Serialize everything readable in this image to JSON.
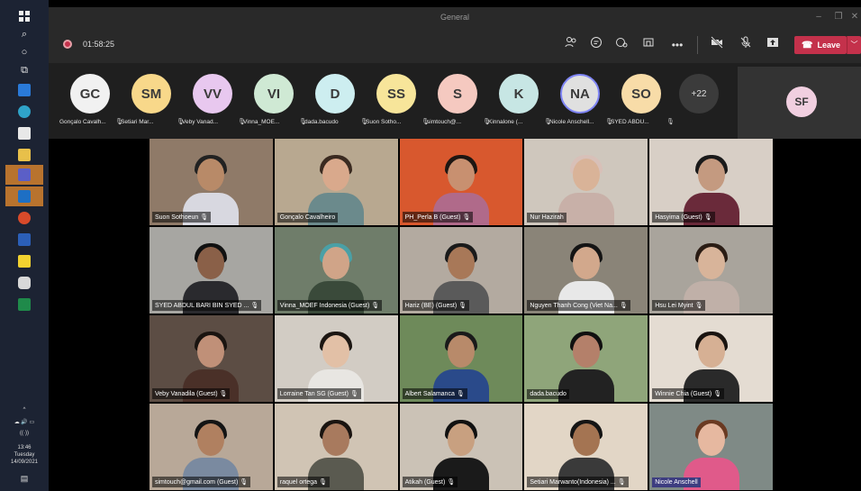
{
  "window": {
    "title": "General"
  },
  "controls": {
    "timer": "01:58:25",
    "leave_label": "Leave"
  },
  "strip": {
    "participants": [
      {
        "initials": "GC",
        "name": "Gonçalo Cavalh...",
        "color": "#f1f1f1"
      },
      {
        "initials": "SM",
        "name": "Setiari Mar...",
        "color": "#f8d88a"
      },
      {
        "initials": "VV",
        "name": "Veby Vanad...",
        "color": "#e8c8ef"
      },
      {
        "initials": "VI",
        "name": "Vinna_MOE...",
        "color": "#cfe9d4"
      },
      {
        "initials": "D",
        "name": "dada.bacudo",
        "color": "#cdeef0"
      },
      {
        "initials": "SS",
        "name": "Suon Sotho...",
        "color": "#f7e59a"
      },
      {
        "initials": "S",
        "name": "simtouch@...",
        "color": "#f5c9c0"
      },
      {
        "initials": "K",
        "name": "Kinnalone (...",
        "color": "#c7e6e4"
      },
      {
        "initials": "NA",
        "name": "Nicole Anschell...",
        "color": "#e0e0e0"
      },
      {
        "initials": "SO",
        "name": "SYED ABDU...",
        "color": "#f8dca8"
      }
    ],
    "more_label": "+22",
    "self_initials": "SF"
  },
  "taskbar": {
    "time": "13:46",
    "day": "Tuesday",
    "date": "14/09/2021"
  },
  "tiles": [
    {
      "name": "Suon Sothoeun",
      "bg": "#8f7a68",
      "skin": "#b88a68",
      "shirt": "#d8d8e0",
      "hair": "#222"
    },
    {
      "name": "Gonçalo Cavalheiro",
      "bg": "#b8a890",
      "skin": "#d9a98c",
      "shirt": "#6b8a8c",
      "hair": "#3a2a20"
    },
    {
      "name": "PH_Perla B (Guest)",
      "bg": "#d8582e",
      "skin": "#c89070",
      "shirt": "#b06a8a",
      "hair": "#1e1612"
    },
    {
      "name": "Nur Hazirah",
      "bg": "#cfc7bd",
      "skin": "#d9b398",
      "shirt": "#c8b0a8",
      "hair": "#d8c0b8"
    },
    {
      "name": "Hasyima (Guest)",
      "bg": "#d8cfc6",
      "skin": "#c49a80",
      "shirt": "#6a2a3a",
      "hair": "#1a1a1a"
    },
    {
      "name": "SYED ABDUL BARI BIN SYED ...",
      "bg": "#a7a6a2",
      "skin": "#8a6048",
      "shirt": "#2a2a2e",
      "hair": "#111"
    },
    {
      "name": "Vinna_MOEF Indonesia (Guest)",
      "bg": "#6f7d6a",
      "skin": "#d0a488",
      "shirt": "#3a4a3a",
      "hair": "#4aa0a6"
    },
    {
      "name": "Hariz (BE) (Guest)",
      "bg": "#b3aaa0",
      "skin": "#a87858",
      "shirt": "#5a5a5a",
      "hair": "#1a1a1a"
    },
    {
      "name": "Nguyen Thanh Cong (Viet Na...",
      "bg": "#8a8478",
      "skin": "#d2a88c",
      "shirt": "#e8e8e8",
      "hair": "#141414"
    },
    {
      "name": "Hsu Lei Myint",
      "bg": "#a9a49c",
      "skin": "#d8b49a",
      "shirt": "#c0b0a8",
      "hair": "#2a1c14"
    },
    {
      "name": "Veby Vanadila (Guest)",
      "bg": "#5c4d44",
      "skin": "#c09078",
      "shirt": "#4a3028",
      "hair": "#1a1410"
    },
    {
      "name": "Lorraine Tan SG (Guest)",
      "bg": "#d2ccc4",
      "skin": "#e2c0a6",
      "shirt": "#e8e6e2",
      "hair": "#1c1612"
    },
    {
      "name": "Albert Salamanca",
      "bg": "#6e8a5a",
      "skin": "#b88a6a",
      "shirt": "#2a4a8a",
      "hair": "#1a1a1a"
    },
    {
      "name": "dada.bacudo",
      "bg": "#8fa57a",
      "skin": "#b4806a",
      "shirt": "#222",
      "hair": "#101010"
    },
    {
      "name": "Winnie Chia (Guest)",
      "bg": "#e4dcd2",
      "skin": "#d6b094",
      "shirt": "#2a2a2a",
      "hair": "#1a1410"
    },
    {
      "name": "simtouch@gmail.com (Guest)",
      "bg": "#b8a898",
      "skin": "#b08060",
      "shirt": "#7a8aa0",
      "hair": "#141414"
    },
    {
      "name": "raquel ortega",
      "bg": "#d0c4b4",
      "skin": "#a87a5e",
      "shirt": "#5a5a50",
      "hair": "#1a1410"
    },
    {
      "name": "Atikah (Guest)",
      "bg": "#cbc2b6",
      "skin": "#c8a080",
      "shirt": "#1a1a1a",
      "hair": "#111"
    },
    {
      "name": "Setiari Marwanto(Indonesia) ...",
      "bg": "#e2d6c6",
      "skin": "#a47452",
      "shirt": "#3a3a3a",
      "hair": "#141414"
    },
    {
      "name": "Nicole Anschell",
      "bg": "#7f8a86",
      "skin": "#e6b8a0",
      "shirt": "#e05a8a",
      "hair": "#6a3a22"
    }
  ]
}
